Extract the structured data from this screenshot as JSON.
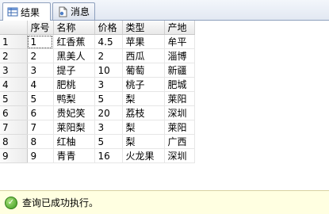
{
  "tabs": [
    {
      "label": "结果",
      "icon": "grid-icon",
      "active": true
    },
    {
      "label": "消息",
      "icon": "messages-icon",
      "active": false
    }
  ],
  "grid": {
    "columns": [
      "序号",
      "名称",
      "价格",
      "类型",
      "产地"
    ],
    "rows": [
      {
        "num": "1",
        "cells": [
          "1",
          "红香蕉",
          "4.5",
          "苹果",
          "牟平"
        ]
      },
      {
        "num": "2",
        "cells": [
          "2",
          "黑美人",
          "2",
          "西瓜",
          "淄博"
        ]
      },
      {
        "num": "3",
        "cells": [
          "3",
          "提子",
          "10",
          "葡萄",
          "新疆"
        ]
      },
      {
        "num": "4",
        "cells": [
          "4",
          "肥桃",
          "3",
          "桃子",
          "肥城"
        ]
      },
      {
        "num": "5",
        "cells": [
          "5",
          "鸭梨",
          "5",
          "梨",
          "莱阳"
        ]
      },
      {
        "num": "6",
        "cells": [
          "6",
          "贵妃笑",
          "20",
          "荔枝",
          "深圳"
        ]
      },
      {
        "num": "7",
        "cells": [
          "7",
          "莱阳梨",
          "3",
          "梨",
          "莱阳"
        ]
      },
      {
        "num": "8",
        "cells": [
          "8",
          "红柚",
          "5",
          "梨",
          "广西"
        ]
      },
      {
        "num": "9",
        "cells": [
          "9",
          "青青",
          "16",
          "火龙果",
          "深圳"
        ]
      }
    ]
  },
  "status": {
    "text": "查询已成功执行。",
    "icon": "success-check-icon",
    "color": "#3c9a1e"
  }
}
